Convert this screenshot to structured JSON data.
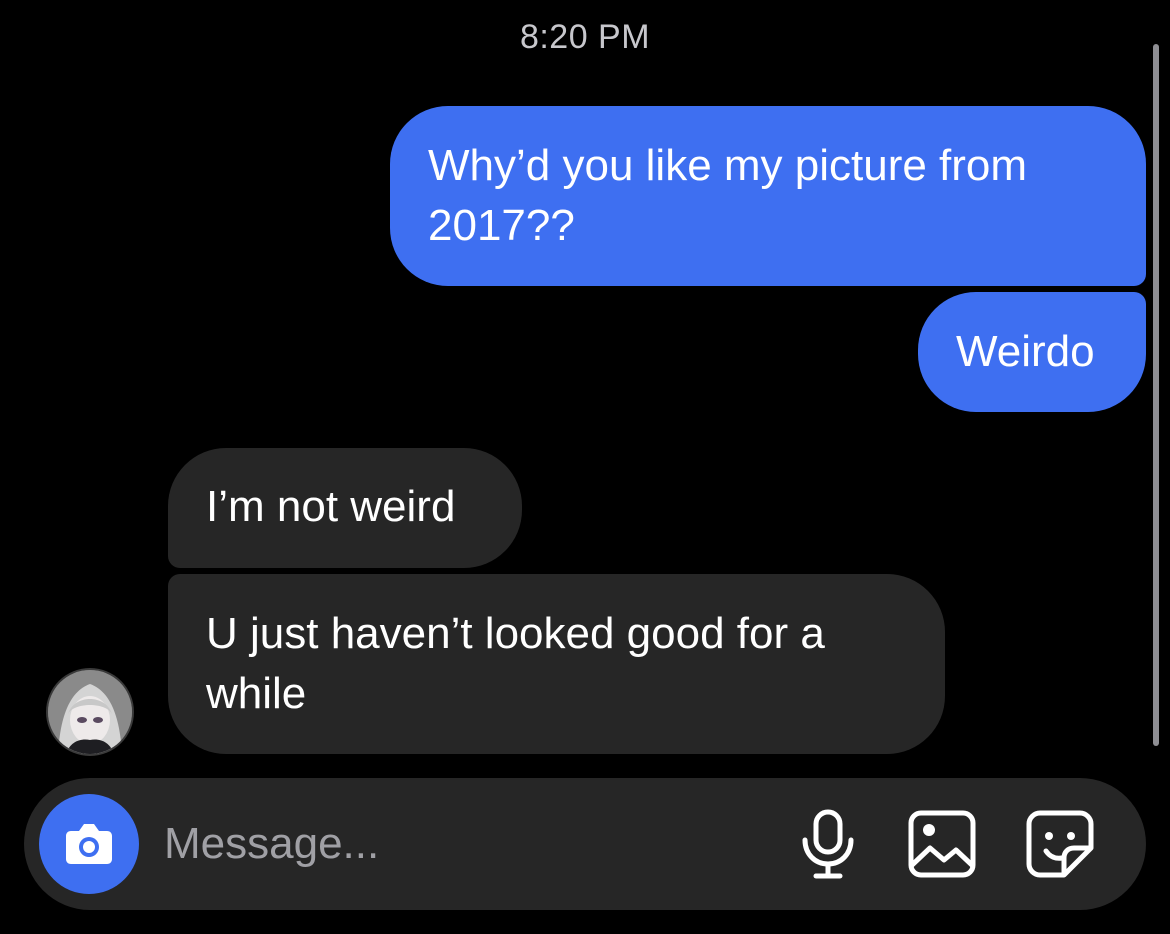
{
  "header": {
    "timestamp": "8:20 PM"
  },
  "messages": [
    {
      "direction": "outgoing",
      "text": "Why’d you like my picture from 2017??"
    },
    {
      "direction": "outgoing",
      "text": "Weirdo"
    },
    {
      "direction": "incoming",
      "text": "I’m not weird"
    },
    {
      "direction": "incoming",
      "text": "U just haven’t looked good for a while"
    }
  ],
  "composer": {
    "placeholder": "Message...",
    "icons": [
      "camera-icon",
      "microphone-icon",
      "image-gallery-icon",
      "sticker-icon"
    ]
  },
  "colors": {
    "background": "#000000",
    "outgoing_bubble": "#3e6ff1",
    "incoming_bubble": "#262626",
    "composer_bar": "#262626",
    "accent": "#3e6ff1"
  }
}
